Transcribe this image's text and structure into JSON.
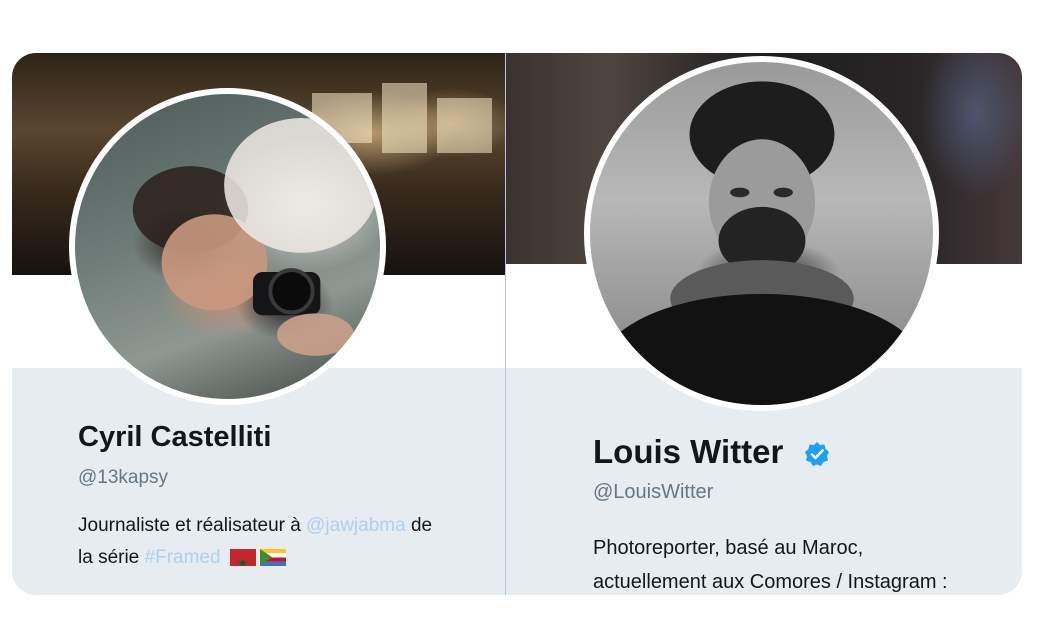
{
  "profiles": [
    {
      "name": "Cyril Castelliti",
      "handle": "@13kapsy",
      "bio_line1_prefix": "Journaliste et réalisateur à ",
      "bio_mention": "@jawjabma",
      "bio_line1_suffix": " de",
      "bio_line2_prefix": "la série ",
      "bio_hashtag": "#Framed",
      "flags": [
        "morocco-flag",
        "comoros-flag"
      ],
      "verified": false
    },
    {
      "name": "Louis Witter",
      "handle": "@LouisWitter",
      "bio_line1": "Photoreporter, basé au Maroc,",
      "bio_line2": "actuellement aux Comores / Instagram :",
      "verified": true
    }
  ],
  "colors": {
    "link": "#aed0f2",
    "verified": "#1da1f2",
    "handle": "#657786",
    "info_background": "#e6ecf0"
  },
  "icons": {
    "verified": "verified-badge-icon"
  }
}
